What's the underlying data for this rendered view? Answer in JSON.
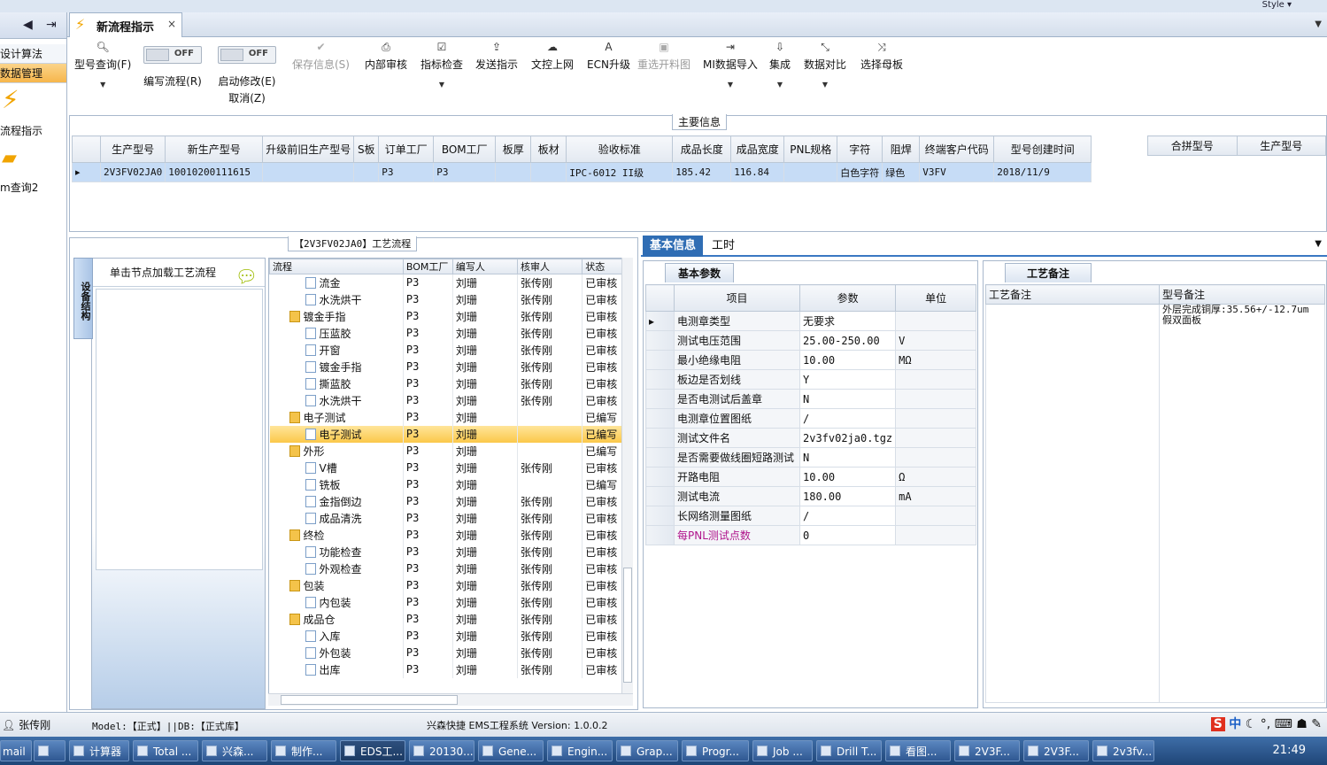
{
  "window": {
    "style_label": "Style ▾"
  },
  "nav": {
    "back_icon": "◀",
    "forward_icon": "⇥",
    "items": [
      "设计算法",
      "数据管理"
    ],
    "big_items": [
      "流程指示",
      "m查询2"
    ]
  },
  "doc_tab": {
    "title": "新流程指示",
    "close": "×"
  },
  "toolbar": {
    "model_query": "型号查询(F)",
    "write_flow": "编写流程(R)",
    "start_modify": "启动修改(E)",
    "cancel": "取消(Z)",
    "toggle_off": "OFF",
    "save_info": "保存信息(S)",
    "internal_review": "内部审核",
    "indicator_check": "指标检查",
    "send_indicator": "发送指示",
    "file_online": "文控上网",
    "ecn_upgrade": "ECN升级",
    "reimport_drawing": "重选开料图",
    "mi_import": "MI数据导入",
    "integrate": "集成",
    "data_compare": "数据对比",
    "select_mother": "选择母板"
  },
  "main_info": {
    "caption": "主要信息",
    "columns": [
      "生产型号",
      "新生产型号",
      "升级前旧生产型号",
      "S板",
      "订单工厂",
      "BOM工厂",
      "板厚",
      "板材",
      "验收标准",
      "成品长度",
      "成品宽度",
      "PNL规格",
      "字符",
      "阻焊",
      "终端客户代码",
      "型号创建时间"
    ],
    "row": [
      "2V3FV02JA0",
      "10010200111615",
      "",
      "",
      "P3",
      "P3",
      "",
      "",
      "IPC-6012 II级",
      "185.42",
      "116.84",
      "",
      "白色字符",
      "绿色",
      "V3FV",
      "2018/11/9"
    ],
    "combo_columns": [
      "合拼型号",
      "生产型号"
    ]
  },
  "process": {
    "caption": "【2V3FV02JA0】工艺流程",
    "side_tab": "设备结构",
    "node_hint": "单击节点加载工艺流程",
    "columns": [
      "流程",
      "BOM工厂",
      "编写人",
      "核审人",
      "状态"
    ],
    "rows": [
      {
        "indent": 2,
        "type": "doc",
        "name": "流金",
        "bom": "P3",
        "writer": "刘珊",
        "reviewer": "张传刚",
        "status": "已审核"
      },
      {
        "indent": 2,
        "type": "doc",
        "name": "水洗烘干",
        "bom": "P3",
        "writer": "刘珊",
        "reviewer": "张传刚",
        "status": "已审核"
      },
      {
        "indent": 1,
        "type": "folder",
        "name": "镀金手指",
        "bom": "P3",
        "writer": "刘珊",
        "reviewer": "张传刚",
        "status": "已审核"
      },
      {
        "indent": 2,
        "type": "doc",
        "name": "压蓝胶",
        "bom": "P3",
        "writer": "刘珊",
        "reviewer": "张传刚",
        "status": "已审核"
      },
      {
        "indent": 2,
        "type": "doc",
        "name": "开窗",
        "bom": "P3",
        "writer": "刘珊",
        "reviewer": "张传刚",
        "status": "已审核"
      },
      {
        "indent": 2,
        "type": "doc",
        "name": "镀金手指",
        "bom": "P3",
        "writer": "刘珊",
        "reviewer": "张传刚",
        "status": "已审核"
      },
      {
        "indent": 2,
        "type": "doc",
        "name": "撕蓝胶",
        "bom": "P3",
        "writer": "刘珊",
        "reviewer": "张传刚",
        "status": "已审核"
      },
      {
        "indent": 2,
        "type": "doc",
        "name": "水洗烘干",
        "bom": "P3",
        "writer": "刘珊",
        "reviewer": "张传刚",
        "status": "已审核"
      },
      {
        "indent": 1,
        "type": "folder",
        "name": "电子测试",
        "bom": "P3",
        "writer": "刘珊",
        "reviewer": "",
        "status": "已编写"
      },
      {
        "indent": 2,
        "type": "doc",
        "name": "电子测试",
        "bom": "P3",
        "writer": "刘珊",
        "reviewer": "",
        "status": "已编写",
        "highlight": true
      },
      {
        "indent": 1,
        "type": "folder",
        "name": "外形",
        "bom": "P3",
        "writer": "刘珊",
        "reviewer": "",
        "status": "已编写"
      },
      {
        "indent": 2,
        "type": "doc",
        "name": "V槽",
        "bom": "P3",
        "writer": "刘珊",
        "reviewer": "张传刚",
        "status": "已审核"
      },
      {
        "indent": 2,
        "type": "doc",
        "name": "铣板",
        "bom": "P3",
        "writer": "刘珊",
        "reviewer": "",
        "status": "已编写"
      },
      {
        "indent": 2,
        "type": "doc",
        "name": "金指倒边",
        "bom": "P3",
        "writer": "刘珊",
        "reviewer": "张传刚",
        "status": "已审核"
      },
      {
        "indent": 2,
        "type": "doc",
        "name": "成品清洗",
        "bom": "P3",
        "writer": "刘珊",
        "reviewer": "张传刚",
        "status": "已审核"
      },
      {
        "indent": 1,
        "type": "folder",
        "name": "终检",
        "bom": "P3",
        "writer": "刘珊",
        "reviewer": "张传刚",
        "status": "已审核"
      },
      {
        "indent": 2,
        "type": "doc",
        "name": "功能检查",
        "bom": "P3",
        "writer": "刘珊",
        "reviewer": "张传刚",
        "status": "已审核"
      },
      {
        "indent": 2,
        "type": "doc",
        "name": "外观检查",
        "bom": "P3",
        "writer": "刘珊",
        "reviewer": "张传刚",
        "status": "已审核"
      },
      {
        "indent": 1,
        "type": "folder",
        "name": "包装",
        "bom": "P3",
        "writer": "刘珊",
        "reviewer": "张传刚",
        "status": "已审核"
      },
      {
        "indent": 2,
        "type": "doc",
        "name": "内包装",
        "bom": "P3",
        "writer": "刘珊",
        "reviewer": "张传刚",
        "status": "已审核"
      },
      {
        "indent": 1,
        "type": "folder",
        "name": "成品仓",
        "bom": "P3",
        "writer": "刘珊",
        "reviewer": "张传刚",
        "status": "已审核"
      },
      {
        "indent": 2,
        "type": "doc",
        "name": "入库",
        "bom": "P3",
        "writer": "刘珊",
        "reviewer": "张传刚",
        "status": "已审核"
      },
      {
        "indent": 2,
        "type": "doc",
        "name": "外包装",
        "bom": "P3",
        "writer": "刘珊",
        "reviewer": "张传刚",
        "status": "已审核"
      },
      {
        "indent": 2,
        "type": "doc",
        "name": "出库",
        "bom": "P3",
        "writer": "刘珊",
        "reviewer": "张传刚",
        "status": "已审核"
      }
    ]
  },
  "detail": {
    "tabs": [
      "基本信息",
      "工时"
    ],
    "basic_tab": "基本参数",
    "columns": [
      "项目",
      "参数",
      "单位"
    ],
    "params": [
      {
        "item": "电测章类型",
        "value": "无要求",
        "unit": ""
      },
      {
        "item": "测试电压范围",
        "value": "25.00-250.00",
        "unit": "V"
      },
      {
        "item": "最小绝缘电阻",
        "value": "10.00",
        "unit": "MΩ"
      },
      {
        "item": "板边是否划线",
        "value": "Y",
        "unit": ""
      },
      {
        "item": "是否电测试后盖章",
        "value": "N",
        "unit": ""
      },
      {
        "item": "电测章位置图纸",
        "value": "/",
        "unit": ""
      },
      {
        "item": "测试文件名",
        "value": "2v3fv02ja0.tgz",
        "unit": ""
      },
      {
        "item": "是否需要做线圈短路测试",
        "value": "N",
        "unit": ""
      },
      {
        "item": "开路电阻",
        "value": "10.00",
        "unit": "Ω"
      },
      {
        "item": "测试电流",
        "value": "180.00",
        "unit": "mA"
      },
      {
        "item": "长网络测量图纸",
        "value": "/",
        "unit": ""
      },
      {
        "item": "每PNL测试点数",
        "value": "0",
        "unit": "",
        "color": "#b0158c"
      }
    ],
    "notes_tab": "工艺备注",
    "notes_columns": [
      "工艺备注",
      "型号备注"
    ],
    "process_note": "",
    "model_note": "外层完成铜厚:35.56+/-12.7um 假双面板"
  },
  "status": {
    "user": "张传刚",
    "model_db": "Model:【正式】||DB:【正式库】",
    "system": "兴森快捷 EMS工程系统 Version: 1.0.0.2",
    "ime": "中"
  },
  "taskbar": {
    "items": [
      "mail",
      "",
      "计算器",
      "Total ...",
      "兴森...",
      "制作...",
      "EDS工...",
      "20130...",
      "Gene...",
      "Engin...",
      "Grap...",
      "Progr...",
      "Job ...",
      "Drill T...",
      "看图...",
      "2V3F...",
      "2V3F...",
      "2v3fv..."
    ],
    "time": "21:49"
  },
  "colors": {
    "accent": "#2f6db4",
    "highlight": "#fbc84a",
    "selected_row": "#c6dcf6"
  }
}
